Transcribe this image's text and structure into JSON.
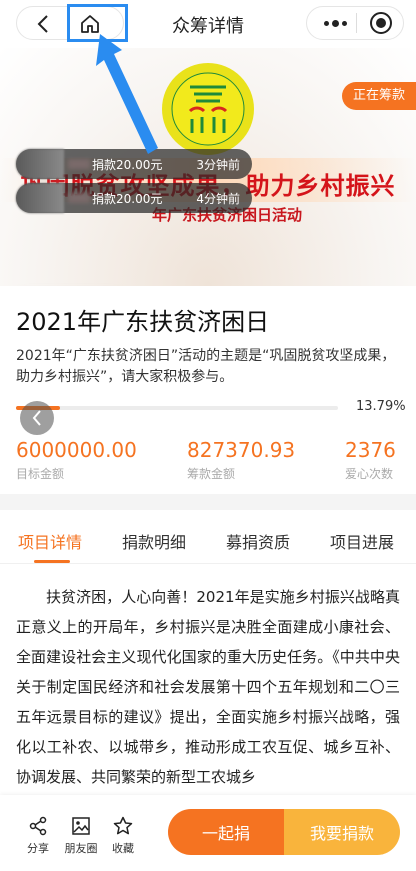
{
  "nav": {
    "title": "众筹详情",
    "back_icon": "chevron-left-icon",
    "home_icon": "home-icon",
    "more_icon": "more-dots-icon",
    "close_icon": "record-close-icon",
    "highlight_color": "#2a8cf0"
  },
  "banner": {
    "status_badge": "正在筹款",
    "slogan": "巩固脱贫攻坚成果，助力乡村振兴",
    "subtitle": "年广东扶贫济困日活动",
    "donations": [
      {
        "amount": "捐款20.00元",
        "time": "3分钟前"
      },
      {
        "amount": "捐款20.00元",
        "time": "4分钟前"
      }
    ]
  },
  "project": {
    "title": "2021年广东扶贫济困日",
    "description": "2021年“广东扶贫济困日”活动的主题是“巩固脱贫攻坚成果，助力乡村振兴”，请大家积极参与。",
    "progress_percent": 13.79,
    "progress_label": "13.79%",
    "stats": [
      {
        "value": "6000000.00",
        "label": "目标金额"
      },
      {
        "value": "827370.93",
        "label": "筹款金额"
      },
      {
        "value": "2376",
        "label": "爱心次数"
      }
    ],
    "accent_color": "#f57321"
  },
  "tabs": [
    {
      "label": "项目详情",
      "active": true
    },
    {
      "label": "捐款明细",
      "active": false
    },
    {
      "label": "募捐资质",
      "active": false
    },
    {
      "label": "项目进展",
      "active": false
    }
  ],
  "article": {
    "text": "扶贫济困，人心向善！2021年是实施乡村振兴战略真正意义上的开局年，乡村振兴是决胜全面建成小康社会、全面建设社会主义现代化国家的重大历史任务。《中共中央关于制定国民经济和社会发展第十四个五年规划和二〇三五年远景目标的建议》提出，全面实施乡村振兴战略，强化以工补农、以城带乡，推动形成工农互促、城乡互补、协调发展、共同繁荣的新型工农城乡"
  },
  "bottom": {
    "actions": [
      {
        "label": "分享",
        "icon": "share-icon"
      },
      {
        "label": "朋友圈",
        "icon": "moments-image-icon"
      },
      {
        "label": "收藏",
        "icon": "star-icon"
      }
    ],
    "together_button": "一起捐",
    "donate_button": "我要捐款",
    "together_color": "#f57321",
    "donate_color": "#f9b43c"
  }
}
